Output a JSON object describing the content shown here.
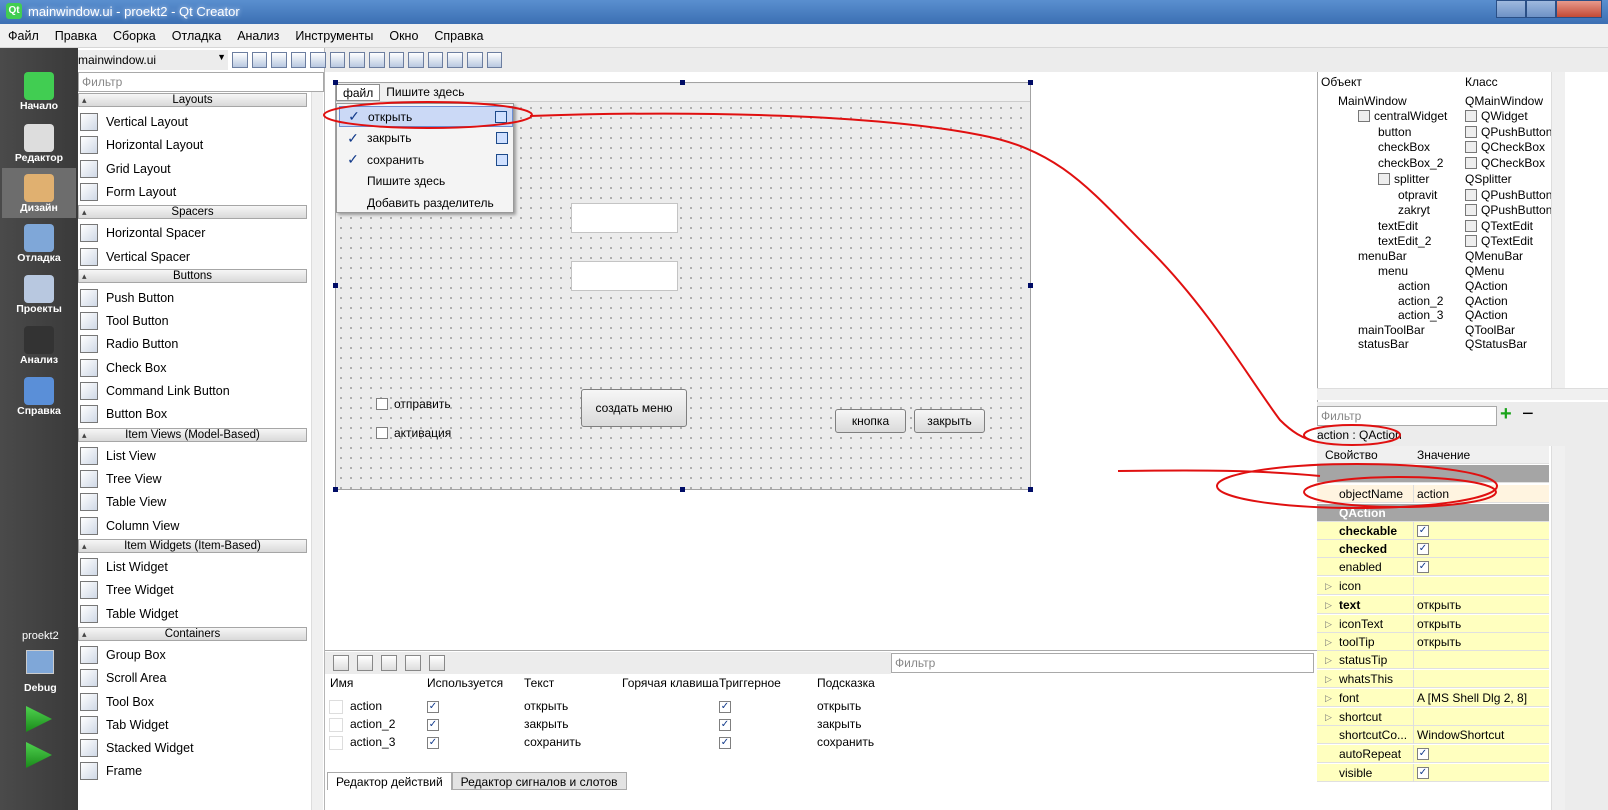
{
  "window": {
    "title": "mainwindow.ui - proekt2 - Qt Creator",
    "qt_logo": "Qt"
  },
  "menubar": [
    "Файл",
    "Правка",
    "Сборка",
    "Отладка",
    "Анализ",
    "Инструменты",
    "Окно",
    "Справка"
  ],
  "modes": [
    {
      "label": "Начало",
      "icon": "qt-logo-icon"
    },
    {
      "label": "Редактор",
      "icon": "edit-icon"
    },
    {
      "label": "Дизайн",
      "icon": "design-icon"
    },
    {
      "label": "Отладка",
      "icon": "debug-icon"
    },
    {
      "label": "Проекты",
      "icon": "projects-icon"
    },
    {
      "label": "Анализ",
      "icon": "analyze-icon"
    },
    {
      "label": "Справка",
      "icon": "help-icon"
    }
  ],
  "project": {
    "name": "proekt2",
    "build": "Debug"
  },
  "file_selector": "mainwindow.ui",
  "widgetbox": {
    "filter_placeholder": "Фильтр",
    "categories": [
      "Layouts",
      "Spacers",
      "Buttons",
      "Item Views (Model-Based)",
      "Item Widgets (Item-Based)",
      "Containers"
    ],
    "items": [
      "Vertical Layout",
      "Horizontal Layout",
      "Grid Layout",
      "Form Layout",
      "Horizontal Spacer",
      "Vertical Spacer",
      "Push Button",
      "Tool Button",
      "Radio Button",
      "Check Box",
      "Command Link Button",
      "Button Box",
      "List View",
      "Tree View",
      "Table View",
      "Column View",
      "List Widget",
      "Tree Widget",
      "Table Widget",
      "Group Box",
      "Scroll Area",
      "Tool Box",
      "Tab Widget",
      "Stacked Widget",
      "Frame"
    ]
  },
  "form": {
    "menus": [
      "файл",
      "Пишите здесь"
    ],
    "dropdown": [
      {
        "label": "открыть",
        "checked": true
      },
      {
        "label": "закрыть",
        "checked": true
      },
      {
        "label": "сохранить",
        "checked": true
      },
      {
        "label": "Пишите здесь",
        "checked": false
      },
      {
        "label": "Добавить разделитель",
        "checked": false
      }
    ],
    "checkboxes": [
      "отправить",
      "активация"
    ],
    "buttons": [
      "создать меню",
      "кнопка",
      "закрыть"
    ]
  },
  "action_editor": {
    "filter_placeholder": "Фильтр",
    "headers": [
      "Имя",
      "Используется",
      "Текст",
      "Горячая клавиша",
      "Триггерное",
      "Подсказка"
    ],
    "rows": [
      {
        "name": "action",
        "used": true,
        "text": "открыть",
        "shortcut": "",
        "checkable": true,
        "tooltip": "открыть"
      },
      {
        "name": "action_2",
        "used": true,
        "text": "закрыть",
        "shortcut": "",
        "checkable": true,
        "tooltip": "закрыть"
      },
      {
        "name": "action_3",
        "used": true,
        "text": "сохранить",
        "shortcut": "",
        "checkable": true,
        "tooltip": "сохранить"
      }
    ],
    "tabs": [
      "Редактор действий",
      "Редактор сигналов и слотов"
    ]
  },
  "object_inspector": {
    "headers": [
      "Объект",
      "Класс"
    ],
    "rows": [
      {
        "obj": "MainWindow",
        "cls": "QMainWindow",
        "level": 0
      },
      {
        "obj": "centralWidget",
        "cls": "QWidget",
        "level": 1
      },
      {
        "obj": "button",
        "cls": "QPushButton",
        "level": 2
      },
      {
        "obj": "checkBox",
        "cls": "QCheckBox",
        "level": 2
      },
      {
        "obj": "checkBox_2",
        "cls": "QCheckBox",
        "level": 2
      },
      {
        "obj": "splitter",
        "cls": "QSplitter",
        "level": 2
      },
      {
        "obj": "otpravit",
        "cls": "QPushButton",
        "level": 3
      },
      {
        "obj": "zakryt",
        "cls": "QPushButton",
        "level": 3
      },
      {
        "obj": "textEdit",
        "cls": "QTextEdit",
        "level": 2
      },
      {
        "obj": "textEdit_2",
        "cls": "QTextEdit",
        "level": 2
      },
      {
        "obj": "menuBar",
        "cls": "QMenuBar",
        "level": 1
      },
      {
        "obj": "menu",
        "cls": "QMenu",
        "level": 2
      },
      {
        "obj": "action",
        "cls": "QAction",
        "level": 3
      },
      {
        "obj": "action_2",
        "cls": "QAction",
        "level": 3
      },
      {
        "obj": "action_3",
        "cls": "QAction",
        "level": 3
      },
      {
        "obj": "mainToolBar",
        "cls": "QToolBar",
        "level": 1
      },
      {
        "obj": "statusBar",
        "cls": "QStatusBar",
        "level": 1
      }
    ]
  },
  "property_editor": {
    "filter_placeholder": "Фильтр",
    "object_label": "action : QAction",
    "headers": [
      "Свойство",
      "Значение"
    ],
    "rows": [
      {
        "name": "objectName",
        "value": "action",
        "type": "text",
        "bold": false,
        "style": "plain"
      },
      {
        "name": "QAction",
        "value": "",
        "type": "header",
        "bold": true,
        "style": "header"
      },
      {
        "name": "checkable",
        "value": "",
        "type": "check",
        "bold": true,
        "style": "yellow"
      },
      {
        "name": "checked",
        "value": "",
        "type": "check",
        "bold": true,
        "style": "yellow"
      },
      {
        "name": "enabled",
        "value": "",
        "type": "check",
        "bold": false,
        "style": "yellow"
      },
      {
        "name": "icon",
        "value": "",
        "type": "text",
        "bold": false,
        "style": "yellow",
        "expand": true
      },
      {
        "name": "text",
        "value": "открыть",
        "type": "text",
        "bold": true,
        "style": "yellow",
        "expand": true
      },
      {
        "name": "iconText",
        "value": "открыть",
        "type": "text",
        "bold": false,
        "style": "yellow",
        "expand": true
      },
      {
        "name": "toolTip",
        "value": "открыть",
        "type": "text",
        "bold": false,
        "style": "yellow",
        "expand": true
      },
      {
        "name": "statusTip",
        "value": "",
        "type": "text",
        "bold": false,
        "style": "yellow",
        "expand": true
      },
      {
        "name": "whatsThis",
        "value": "",
        "type": "text",
        "bold": false,
        "style": "yellow",
        "expand": true
      },
      {
        "name": "font",
        "value": "A  [MS Shell Dlg 2, 8]",
        "type": "text",
        "bold": false,
        "style": "yellow",
        "expand": true
      },
      {
        "name": "shortcut",
        "value": "",
        "type": "text",
        "bold": false,
        "style": "yellow",
        "expand": true
      },
      {
        "name": "shortcutCo...",
        "value": "WindowShortcut",
        "type": "text",
        "bold": false,
        "style": "yellow"
      },
      {
        "name": "autoRepeat",
        "value": "",
        "type": "check",
        "bold": false,
        "style": "yellow"
      },
      {
        "name": "visible",
        "value": "",
        "type": "check",
        "bold": false,
        "style": "yellow"
      }
    ]
  },
  "colors": {
    "annotation": "#e01010",
    "accent": "#3b6fb3",
    "property_yellow": "#ffffbf"
  }
}
